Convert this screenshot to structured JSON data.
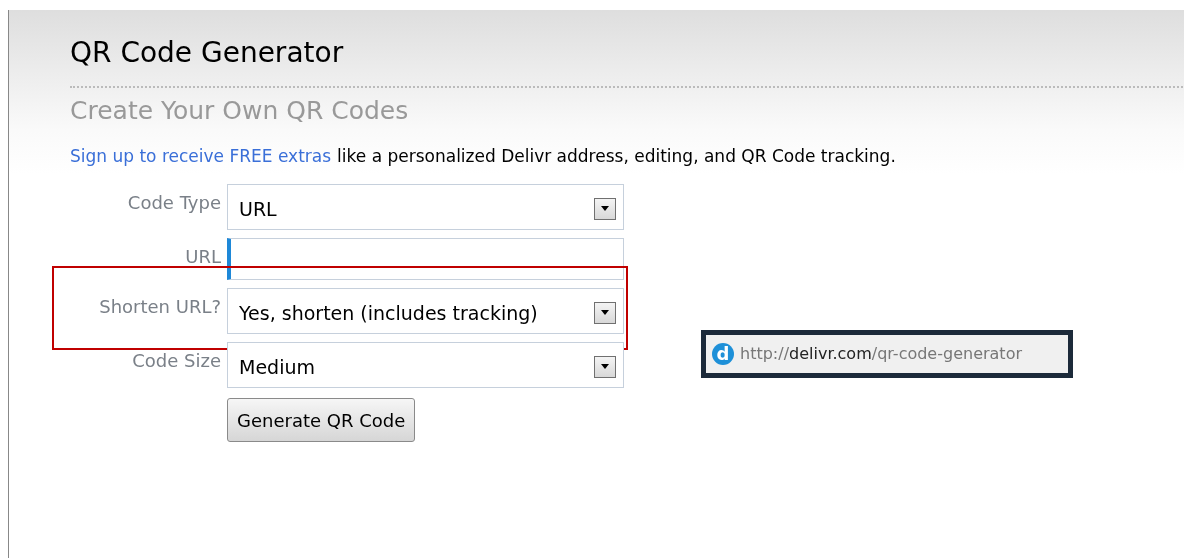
{
  "page": {
    "title": "QR Code Generator",
    "subtitle": "Create Your Own QR Codes"
  },
  "intro": {
    "link": "Sign up to receive FREE extras",
    "text": "like a personalized Delivr address, editing, and QR Code tracking."
  },
  "form": {
    "fields": [
      {
        "kind": "select",
        "label": "Code Type",
        "value": "URL"
      },
      {
        "kind": "text",
        "label": "URL",
        "focused": true
      },
      {
        "kind": "select",
        "label": "Shorten URL?",
        "value": "Yes, shorten (includes tracking)",
        "highlighted": true
      },
      {
        "kind": "select",
        "label": "Code Size",
        "value": "Medium"
      }
    ],
    "submit": "Generate QR Code"
  },
  "address_bar": {
    "icon_letter": "d",
    "scheme": "http://",
    "domain": "delivr.com",
    "path": "/qr-code-generator"
  }
}
